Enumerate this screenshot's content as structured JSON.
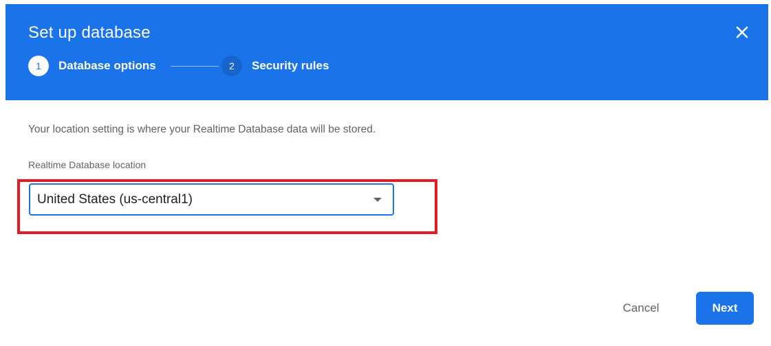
{
  "dialog": {
    "title": "Set up database",
    "close_icon": "close-icon"
  },
  "stepper": {
    "steps": [
      {
        "number": "1",
        "label": "Database options",
        "active": true
      },
      {
        "number": "2",
        "label": "Security rules",
        "active": false
      }
    ]
  },
  "content": {
    "description": "Your location setting is where your Realtime Database data will be stored.",
    "location_label": "Realtime Database location",
    "location_value": "United States (us-central1)",
    "dropdown_icon": "dropdown-arrow-icon"
  },
  "actions": {
    "cancel_label": "Cancel",
    "next_label": "Next"
  },
  "colors": {
    "header_bg": "#1a73e8",
    "primary": "#1a73e8",
    "highlight": "#e41b23",
    "secondary_text": "#5f6368"
  }
}
